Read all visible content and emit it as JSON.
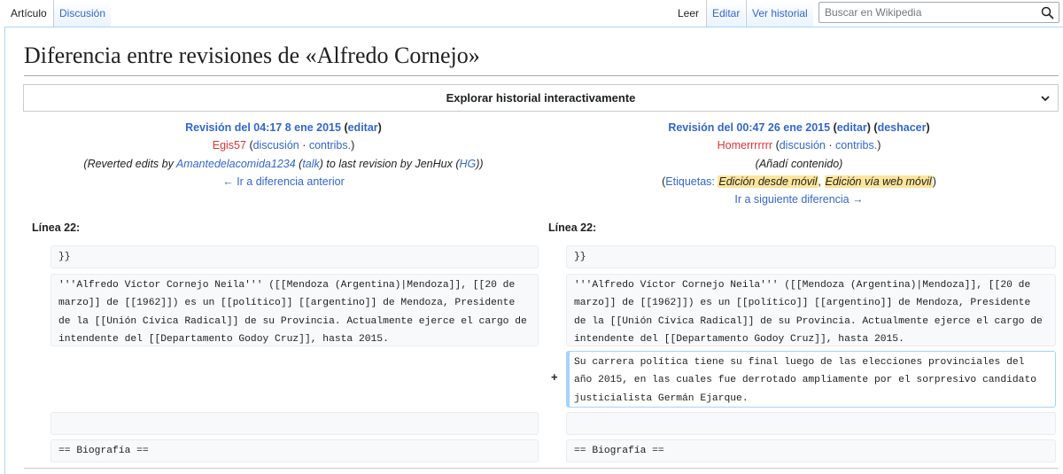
{
  "tabs_left": [
    {
      "label": "Artículo"
    },
    {
      "label": "Discusión"
    }
  ],
  "tabs_right": [
    {
      "label": "Leer"
    },
    {
      "label": "Editar"
    },
    {
      "label": "Ver historial"
    }
  ],
  "search": {
    "placeholder": "Buscar en Wikipedia"
  },
  "page_title": "Diferencia entre revisiones de «Alfredo Cornejo»",
  "explore_label": "Explorar historial interactivamente",
  "left_rev": {
    "title": "Revisión del 04:17 8 ene 2015",
    "edit_link": "editar",
    "user": "Egis57",
    "talk": "discusión",
    "contribs": "contribs.",
    "summary_pre": "Reverted edits by ",
    "summary_user": "Amantedelacomida1234",
    "summary_talk": "talk",
    "summary_mid": " to last revision by JenHux (",
    "summary_tool": "HG",
    "summary_post": ")",
    "nav": "← Ir a diferencia anterior"
  },
  "right_rev": {
    "title": "Revisión del 00:47 26 ene 2015",
    "edit_link": "editar",
    "undo_link": "deshacer",
    "user": "Homerrrrrrr",
    "talk": "discusión",
    "contribs": "contribs.",
    "summary": "Añadí contenido",
    "tags_label": "Etiquetas: ",
    "tag1": "Edición desde móvil",
    "tag2": "Edición vía web móvil",
    "nav": "Ir a siguiente diferencia →"
  },
  "left_line_label": "Línea 22:",
  "right_line_label": "Línea 22:",
  "diff": {
    "context1": "}}",
    "context2": "'''Alfredo Víctor Cornejo Neila''' ([[Mendoza (Argentina)|Mendoza]], [[20 de marzo]] de [[1962]]) es un [[político]] [[argentino]] de Mendoza, Presidente de la [[Unión Cívica Radical]] de su Provincia. Actualmente ejerce el cargo de intendente del [[Departamento Godoy Cruz]], hasta 2015.",
    "added_marker": "+",
    "added_text": "Su carrera política tiene su final luego de las elecciones provinciales del año 2015, en las cuales fue derrotado ampliamente por el sorpresivo candidato justicialista Germán Ejarque.",
    "context4": "== Biografía =="
  }
}
